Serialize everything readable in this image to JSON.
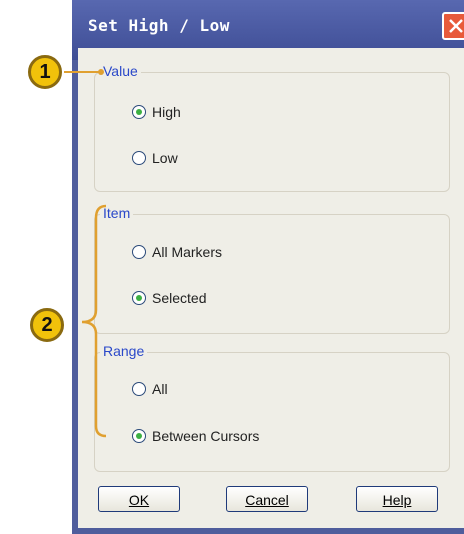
{
  "dialog": {
    "title": "Set High / Low",
    "groups": {
      "value": {
        "label": "Value",
        "options": [
          {
            "label": "High",
            "selected": true
          },
          {
            "label": "Low",
            "selected": false
          }
        ]
      },
      "item": {
        "label": "Item",
        "options": [
          {
            "label": "All Markers",
            "selected": false
          },
          {
            "label": "Selected",
            "selected": true
          }
        ]
      },
      "range": {
        "label": "Range",
        "options": [
          {
            "label": "All",
            "selected": false
          },
          {
            "label": "Between Cursors",
            "selected": true
          }
        ]
      }
    },
    "buttons": {
      "ok": "OK",
      "cancel": "Cancel",
      "help": "Help"
    }
  },
  "callouts": {
    "one": "1",
    "two": "2"
  },
  "icons": {
    "close": "close-icon",
    "radio": "radio-icon"
  },
  "colors": {
    "title_bar": "#3e4d95",
    "client_bg": "#efeee7",
    "group_label": "#2a48c9",
    "callout_fill": "#f1c20b",
    "callout_line": "#e0a030"
  }
}
